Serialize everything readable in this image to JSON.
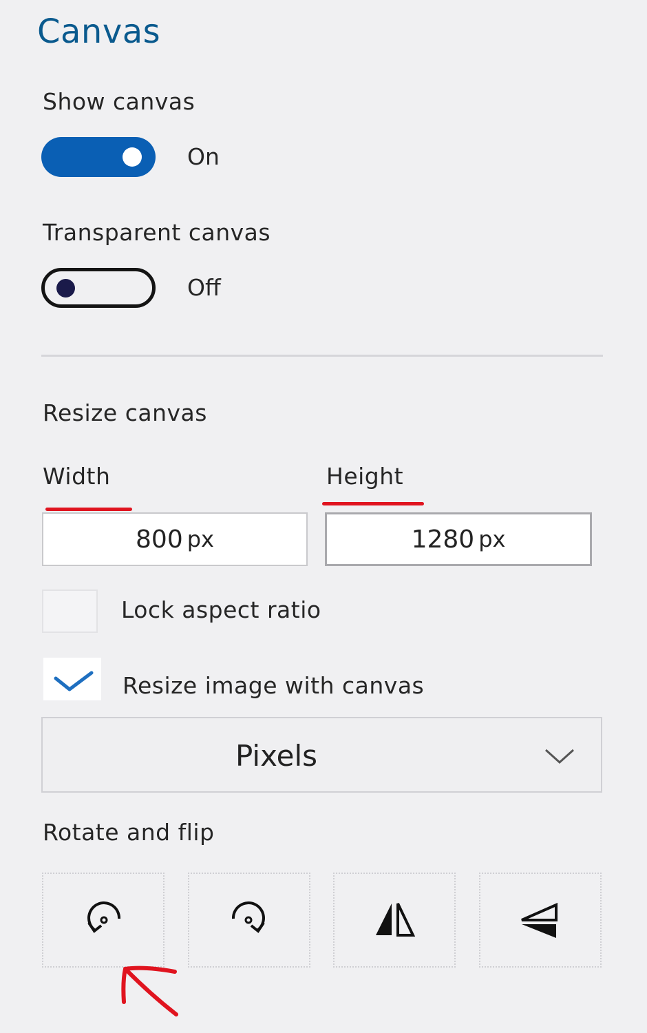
{
  "panel": {
    "title": "Canvas",
    "show_canvas": {
      "label": "Show canvas",
      "state_text": "On",
      "on": true
    },
    "transparent_canvas": {
      "label": "Transparent canvas",
      "state_text": "Off",
      "on": false
    },
    "resize": {
      "heading": "Resize canvas",
      "width_label": "Width",
      "height_label": "Height",
      "width_value": "800",
      "height_value": "1280",
      "unit": "px",
      "lock_aspect": {
        "label": "Lock aspect ratio",
        "checked": false
      },
      "resize_image": {
        "label": "Resize image with canvas",
        "checked": true
      },
      "units_select": {
        "value": "Pixels"
      }
    },
    "rotate_flip": {
      "heading": "Rotate and flip",
      "buttons": [
        {
          "icon": "rotate-left-icon"
        },
        {
          "icon": "rotate-right-icon"
        },
        {
          "icon": "flip-horizontal-icon"
        },
        {
          "icon": "flip-vertical-icon"
        }
      ]
    }
  },
  "colors": {
    "accent": "#0a5fb4",
    "title": "#0a5a8e",
    "annotation": "#e0141f",
    "background": "#f0f0f2"
  }
}
